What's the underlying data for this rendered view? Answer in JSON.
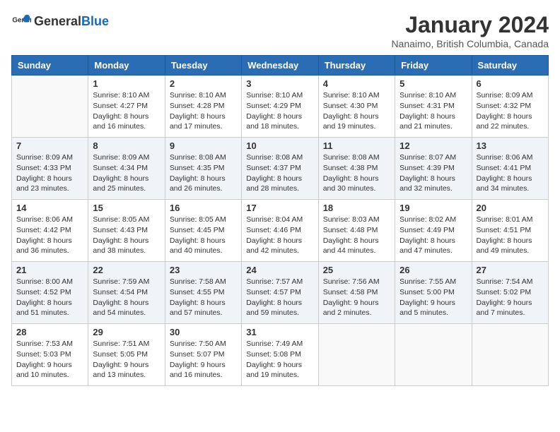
{
  "header": {
    "logo_general": "General",
    "logo_blue": "Blue",
    "month": "January 2024",
    "location": "Nanaimo, British Columbia, Canada"
  },
  "days_of_week": [
    "Sunday",
    "Monday",
    "Tuesday",
    "Wednesday",
    "Thursday",
    "Friday",
    "Saturday"
  ],
  "weeks": [
    [
      {
        "day": "",
        "info": ""
      },
      {
        "day": "1",
        "info": "Sunrise: 8:10 AM\nSunset: 4:27 PM\nDaylight: 8 hours\nand 16 minutes."
      },
      {
        "day": "2",
        "info": "Sunrise: 8:10 AM\nSunset: 4:28 PM\nDaylight: 8 hours\nand 17 minutes."
      },
      {
        "day": "3",
        "info": "Sunrise: 8:10 AM\nSunset: 4:29 PM\nDaylight: 8 hours\nand 18 minutes."
      },
      {
        "day": "4",
        "info": "Sunrise: 8:10 AM\nSunset: 4:30 PM\nDaylight: 8 hours\nand 19 minutes."
      },
      {
        "day": "5",
        "info": "Sunrise: 8:10 AM\nSunset: 4:31 PM\nDaylight: 8 hours\nand 21 minutes."
      },
      {
        "day": "6",
        "info": "Sunrise: 8:09 AM\nSunset: 4:32 PM\nDaylight: 8 hours\nand 22 minutes."
      }
    ],
    [
      {
        "day": "7",
        "info": "Sunrise: 8:09 AM\nSunset: 4:33 PM\nDaylight: 8 hours\nand 23 minutes."
      },
      {
        "day": "8",
        "info": "Sunrise: 8:09 AM\nSunset: 4:34 PM\nDaylight: 8 hours\nand 25 minutes."
      },
      {
        "day": "9",
        "info": "Sunrise: 8:08 AM\nSunset: 4:35 PM\nDaylight: 8 hours\nand 26 minutes."
      },
      {
        "day": "10",
        "info": "Sunrise: 8:08 AM\nSunset: 4:37 PM\nDaylight: 8 hours\nand 28 minutes."
      },
      {
        "day": "11",
        "info": "Sunrise: 8:08 AM\nSunset: 4:38 PM\nDaylight: 8 hours\nand 30 minutes."
      },
      {
        "day": "12",
        "info": "Sunrise: 8:07 AM\nSunset: 4:39 PM\nDaylight: 8 hours\nand 32 minutes."
      },
      {
        "day": "13",
        "info": "Sunrise: 8:06 AM\nSunset: 4:41 PM\nDaylight: 8 hours\nand 34 minutes."
      }
    ],
    [
      {
        "day": "14",
        "info": "Sunrise: 8:06 AM\nSunset: 4:42 PM\nDaylight: 8 hours\nand 36 minutes."
      },
      {
        "day": "15",
        "info": "Sunrise: 8:05 AM\nSunset: 4:43 PM\nDaylight: 8 hours\nand 38 minutes."
      },
      {
        "day": "16",
        "info": "Sunrise: 8:05 AM\nSunset: 4:45 PM\nDaylight: 8 hours\nand 40 minutes."
      },
      {
        "day": "17",
        "info": "Sunrise: 8:04 AM\nSunset: 4:46 PM\nDaylight: 8 hours\nand 42 minutes."
      },
      {
        "day": "18",
        "info": "Sunrise: 8:03 AM\nSunset: 4:48 PM\nDaylight: 8 hours\nand 44 minutes."
      },
      {
        "day": "19",
        "info": "Sunrise: 8:02 AM\nSunset: 4:49 PM\nDaylight: 8 hours\nand 47 minutes."
      },
      {
        "day": "20",
        "info": "Sunrise: 8:01 AM\nSunset: 4:51 PM\nDaylight: 8 hours\nand 49 minutes."
      }
    ],
    [
      {
        "day": "21",
        "info": "Sunrise: 8:00 AM\nSunset: 4:52 PM\nDaylight: 8 hours\nand 51 minutes."
      },
      {
        "day": "22",
        "info": "Sunrise: 7:59 AM\nSunset: 4:54 PM\nDaylight: 8 hours\nand 54 minutes."
      },
      {
        "day": "23",
        "info": "Sunrise: 7:58 AM\nSunset: 4:55 PM\nDaylight: 8 hours\nand 57 minutes."
      },
      {
        "day": "24",
        "info": "Sunrise: 7:57 AM\nSunset: 4:57 PM\nDaylight: 8 hours\nand 59 minutes."
      },
      {
        "day": "25",
        "info": "Sunrise: 7:56 AM\nSunset: 4:58 PM\nDaylight: 9 hours\nand 2 minutes."
      },
      {
        "day": "26",
        "info": "Sunrise: 7:55 AM\nSunset: 5:00 PM\nDaylight: 9 hours\nand 5 minutes."
      },
      {
        "day": "27",
        "info": "Sunrise: 7:54 AM\nSunset: 5:02 PM\nDaylight: 9 hours\nand 7 minutes."
      }
    ],
    [
      {
        "day": "28",
        "info": "Sunrise: 7:53 AM\nSunset: 5:03 PM\nDaylight: 9 hours\nand 10 minutes."
      },
      {
        "day": "29",
        "info": "Sunrise: 7:51 AM\nSunset: 5:05 PM\nDaylight: 9 hours\nand 13 minutes."
      },
      {
        "day": "30",
        "info": "Sunrise: 7:50 AM\nSunset: 5:07 PM\nDaylight: 9 hours\nand 16 minutes."
      },
      {
        "day": "31",
        "info": "Sunrise: 7:49 AM\nSunset: 5:08 PM\nDaylight: 9 hours\nand 19 minutes."
      },
      {
        "day": "",
        "info": ""
      },
      {
        "day": "",
        "info": ""
      },
      {
        "day": "",
        "info": ""
      }
    ]
  ]
}
